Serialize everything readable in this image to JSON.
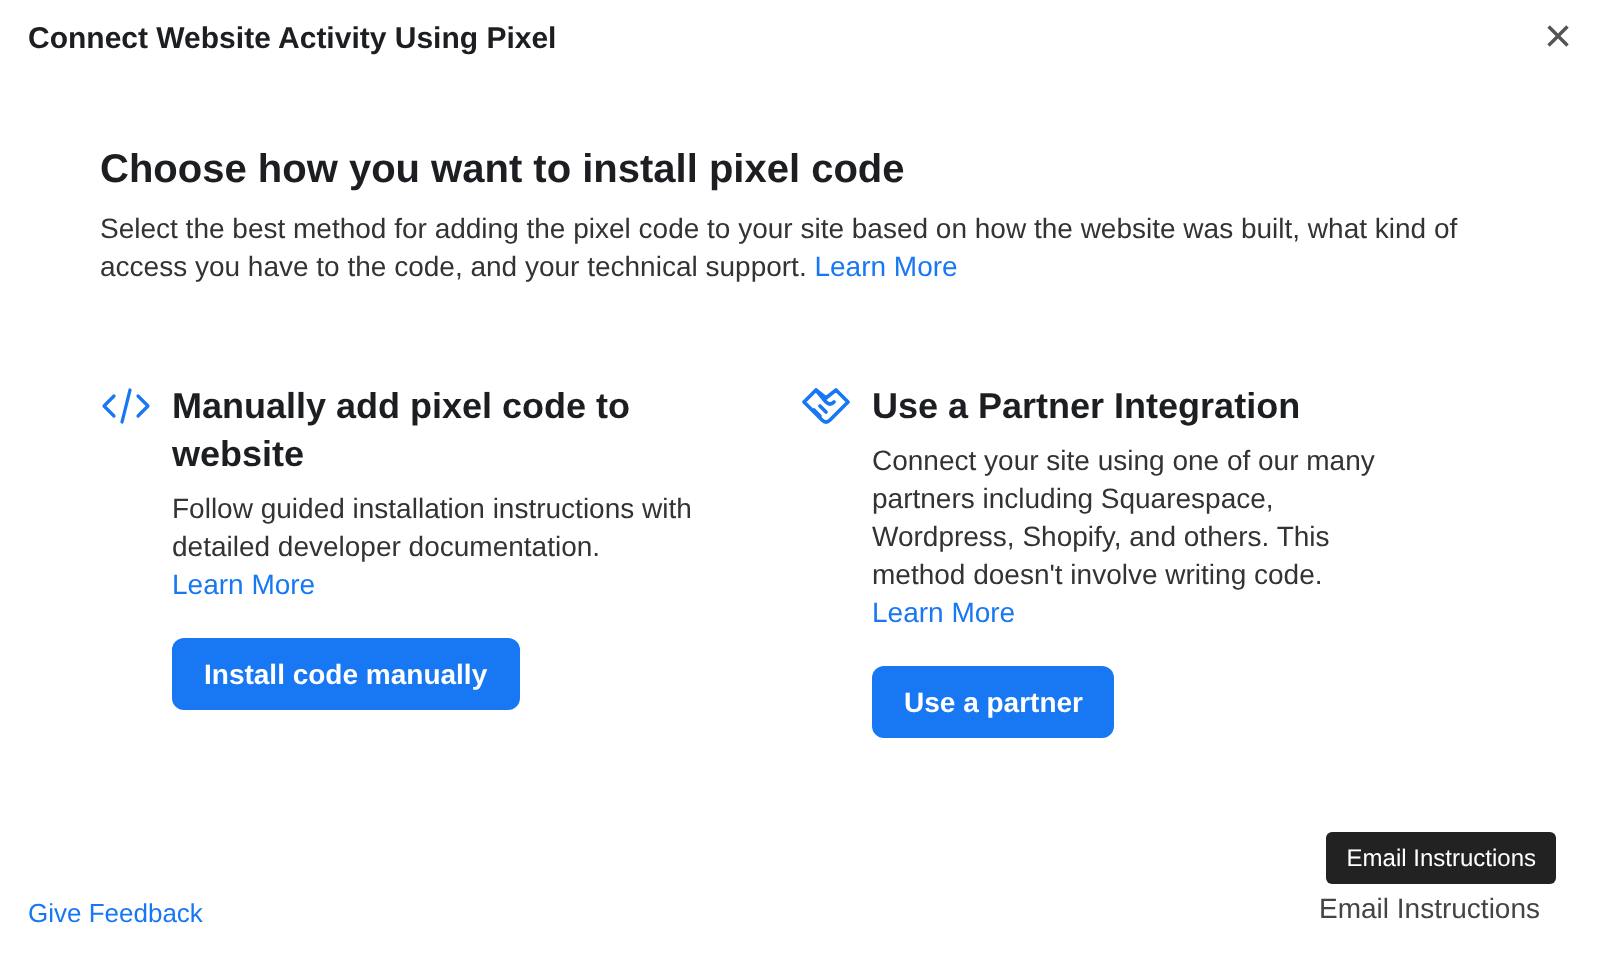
{
  "window": {
    "title": "Connect Website Activity Using Pixel",
    "close": "×"
  },
  "heading": "Choose how you want to install pixel code",
  "intro": {
    "text": "Select the best method for adding the pixel code to your site based on how the website was built, what kind of access you have to the code, and your technical support.",
    "link": "Learn More"
  },
  "options": [
    {
      "kind": "code",
      "title": "Manually add pixel code to website",
      "body": "Follow guided installation instructions with detailed developer documentation.",
      "link": "Learn More",
      "button": "Install code manually"
    },
    {
      "kind": "partner",
      "title": "Use a Partner Integration",
      "body": "Connect your site using one of our many partners including Squarespace, Wordpress, Shopify, and others. This method doesn't involve writing code.",
      "link": "Learn More",
      "button": "Use a partner"
    }
  ],
  "footer": {
    "feedback": "Give Feedback",
    "email": "Email Instructions",
    "tooltip": "Email Instructions"
  }
}
